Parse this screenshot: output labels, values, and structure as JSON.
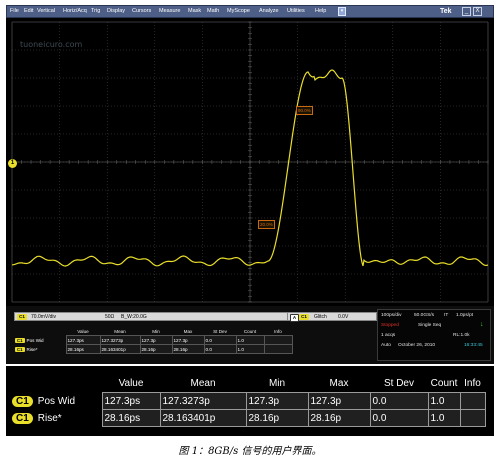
{
  "menubar": {
    "items": [
      "File",
      "Edit",
      "Vertical",
      "Horiz/Acq",
      "Trig",
      "Display",
      "Cursors",
      "Measure",
      "Mask",
      "Math",
      "MyScope",
      "Analyze",
      "Utilities",
      "Help"
    ],
    "brand": "Tek",
    "minimize": "_",
    "close": "X"
  },
  "watermark": "tuoneicuro.com",
  "waveform": {
    "color": "#e9de2a",
    "ref_labels": [
      "90.0%",
      "20.0%"
    ],
    "channel_marker": "1"
  },
  "channel_readout": {
    "badge": "C1",
    "scale": "70.0mV/div",
    "coupling": "50Ω",
    "bandwidth": "B_W:20.0G"
  },
  "glitch_readout": {
    "badge": "A",
    "source": "C1",
    "label": "Glitch",
    "level": "0.0V"
  },
  "timebase": {
    "timescale": "100ps/div",
    "sample_rate": "50.0GS/s",
    "mode": "IT",
    "resolution": "1.0ps/pt",
    "status": "Stopped",
    "acq_mode": "Single Seq",
    "acqs": "1 acqs",
    "record_length": "RL:1.0k",
    "trigger_mode": "Auto",
    "date": "October 26, 2010",
    "time": "16:33:45",
    "status_color": "#e0312a",
    "time_color": "#39c7d8"
  },
  "measurements": {
    "headers": [
      "Value",
      "Mean",
      "Min",
      "Max",
      "St Dev",
      "Count",
      "Info"
    ],
    "rows": [
      {
        "channel": "C1",
        "name": "Pos Wid",
        "value": "127.3ps",
        "mean": "127.3273p",
        "min": "127.3p",
        "max": "127.3p",
        "stdev": "0.0",
        "count": "1.0",
        "info": ""
      },
      {
        "channel": "C1",
        "name": "Rise*",
        "value": "28.16ps",
        "mean": "28.163401p",
        "min": "28.16p",
        "max": "28.16p",
        "stdev": "0.0",
        "count": "1.0",
        "info": ""
      }
    ]
  },
  "caption": "图 1：8GB/s 信号的用户界面。"
}
